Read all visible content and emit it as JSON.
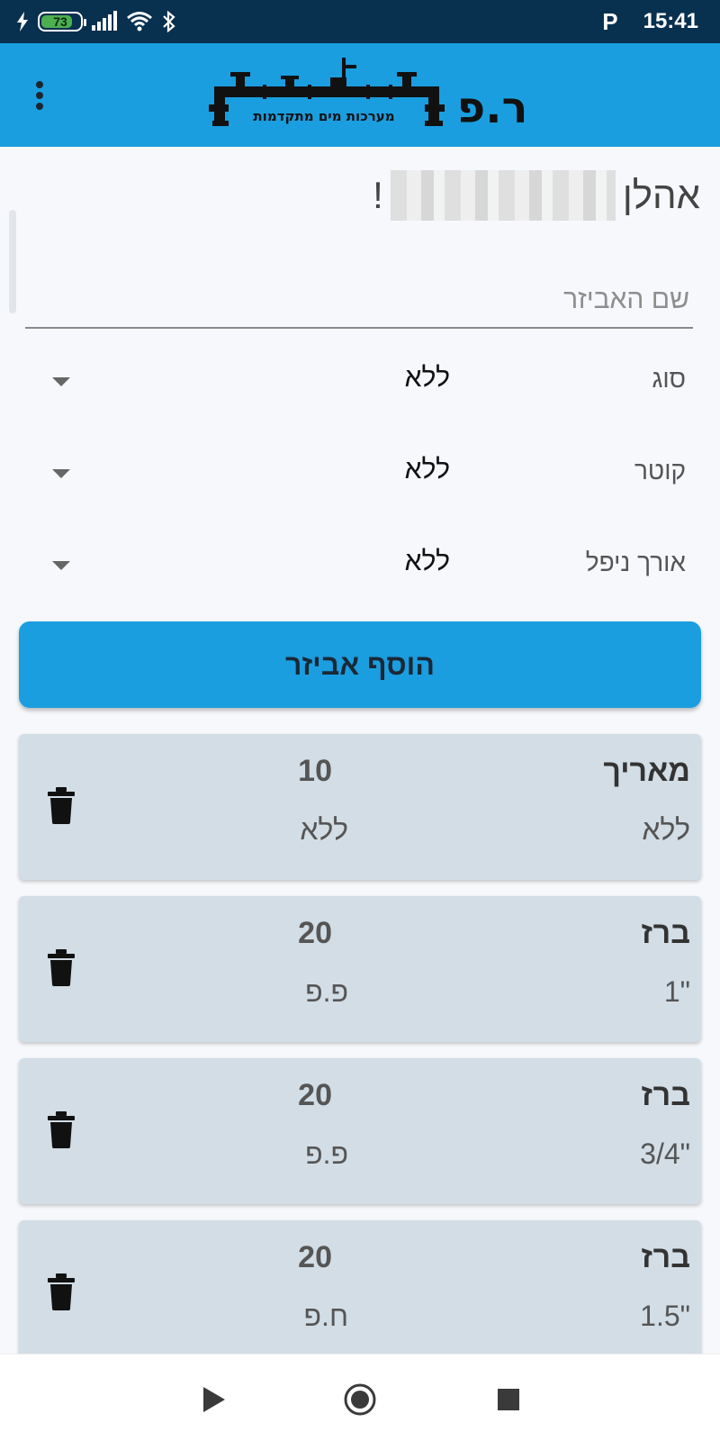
{
  "status": {
    "battery": "73",
    "time": "15:41",
    "icons": [
      "charging-bolt-icon",
      "battery-icon",
      "signal-icon",
      "wifi-icon",
      "bluetooth-icon",
      "parking-p-icon"
    ]
  },
  "header": {
    "logo_initials": "ר.פ",
    "logo_tagline": "מערכות מים מתקדמות",
    "menu_icon": "more-vertical-icon"
  },
  "greeting": {
    "hello": "אהלן",
    "exclaim": "!"
  },
  "form": {
    "name_placeholder": "שם האביזר",
    "name_value": "",
    "fields": [
      {
        "label": "סוג",
        "value": "ללא"
      },
      {
        "label": "קוטר",
        "value": "ללא"
      },
      {
        "label": "אורך ניפל",
        "value": "ללא"
      }
    ],
    "add_button": "הוסף אביזר"
  },
  "items": [
    {
      "name": "מאריך",
      "qty": "10",
      "size": "ללא",
      "conn": ""
    },
    {
      "name": "ברז",
      "qty": "20",
      "size": "1\"",
      "conn": "פ.פ"
    },
    {
      "name": "ברז",
      "qty": "20",
      "size": "3/4\"",
      "conn": "פ.פ"
    },
    {
      "name": "ברז",
      "qty": "20",
      "size": "1.5\"",
      "conn": "ח.פ"
    }
  ],
  "item_first_conn": "ללא",
  "colors": {
    "app_bar": "#1a9ee0",
    "status_bar": "#08304f",
    "card": "#d2dde6",
    "background": "#f6f8fb"
  }
}
